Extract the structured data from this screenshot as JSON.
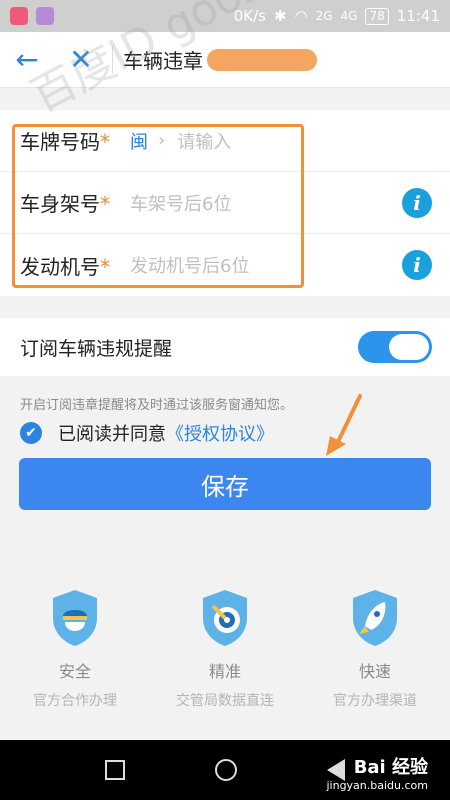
{
  "statusbar": {
    "net_speed": "0K/s",
    "signal1": "2G",
    "signal2": "4G",
    "battery": "78",
    "time": "11:41"
  },
  "header": {
    "title": "车辆违章"
  },
  "watermark": "百度ID gooz",
  "form": {
    "plate": {
      "label": "车牌号码",
      "province": "闽",
      "placeholder": "请输入"
    },
    "frame": {
      "label": "车身架号",
      "placeholder": "车架号后6位"
    },
    "engine": {
      "label": "发动机号",
      "placeholder": "发动机号后6位"
    },
    "required_mark": "*"
  },
  "subscribe": {
    "label": "订阅车辆违规提醒",
    "enabled": true
  },
  "notice": "开启订阅违章提醒将及时通过该服务窗通知您。",
  "agreement": {
    "text": "已阅读并同意",
    "link": "《授权协议》",
    "checked": true
  },
  "save_label": "保存",
  "features": [
    {
      "title": "安全",
      "subtitle": "官方合作办理",
      "icon": "police-shield-icon"
    },
    {
      "title": "精准",
      "subtitle": "交管局数据直连",
      "icon": "target-shield-icon"
    },
    {
      "title": "快速",
      "subtitle": "官方办理渠道",
      "icon": "rocket-shield-icon"
    }
  ],
  "baidu": {
    "brand": "Bai 经验",
    "url": "jingyan.baidu.com"
  },
  "colors": {
    "accent": "#2a84e0",
    "highlight": "#f0913a",
    "button": "#3b86ef"
  }
}
